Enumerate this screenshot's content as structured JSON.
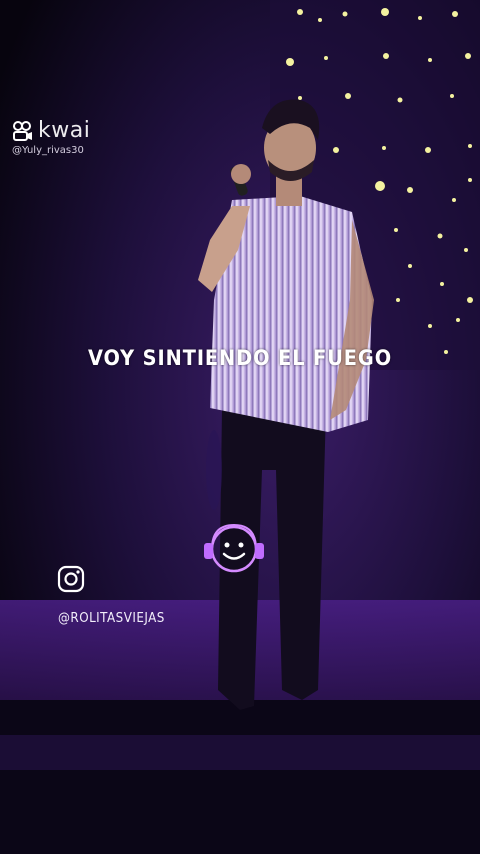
{
  "watermark": {
    "brand": "kwai",
    "username": "@Yuly_rivas30"
  },
  "lyric": "VOY SINTIENDO EL FUEGO",
  "social": {
    "icon": "instagram-icon",
    "handle": "@ROLITASVIEJAS"
  },
  "logo": {
    "icon": "smiley-headphones-icon"
  },
  "colors": {
    "accent": "#c06cff",
    "stage_purple": "#3a1a6b",
    "lights": "#f4f2a0"
  }
}
